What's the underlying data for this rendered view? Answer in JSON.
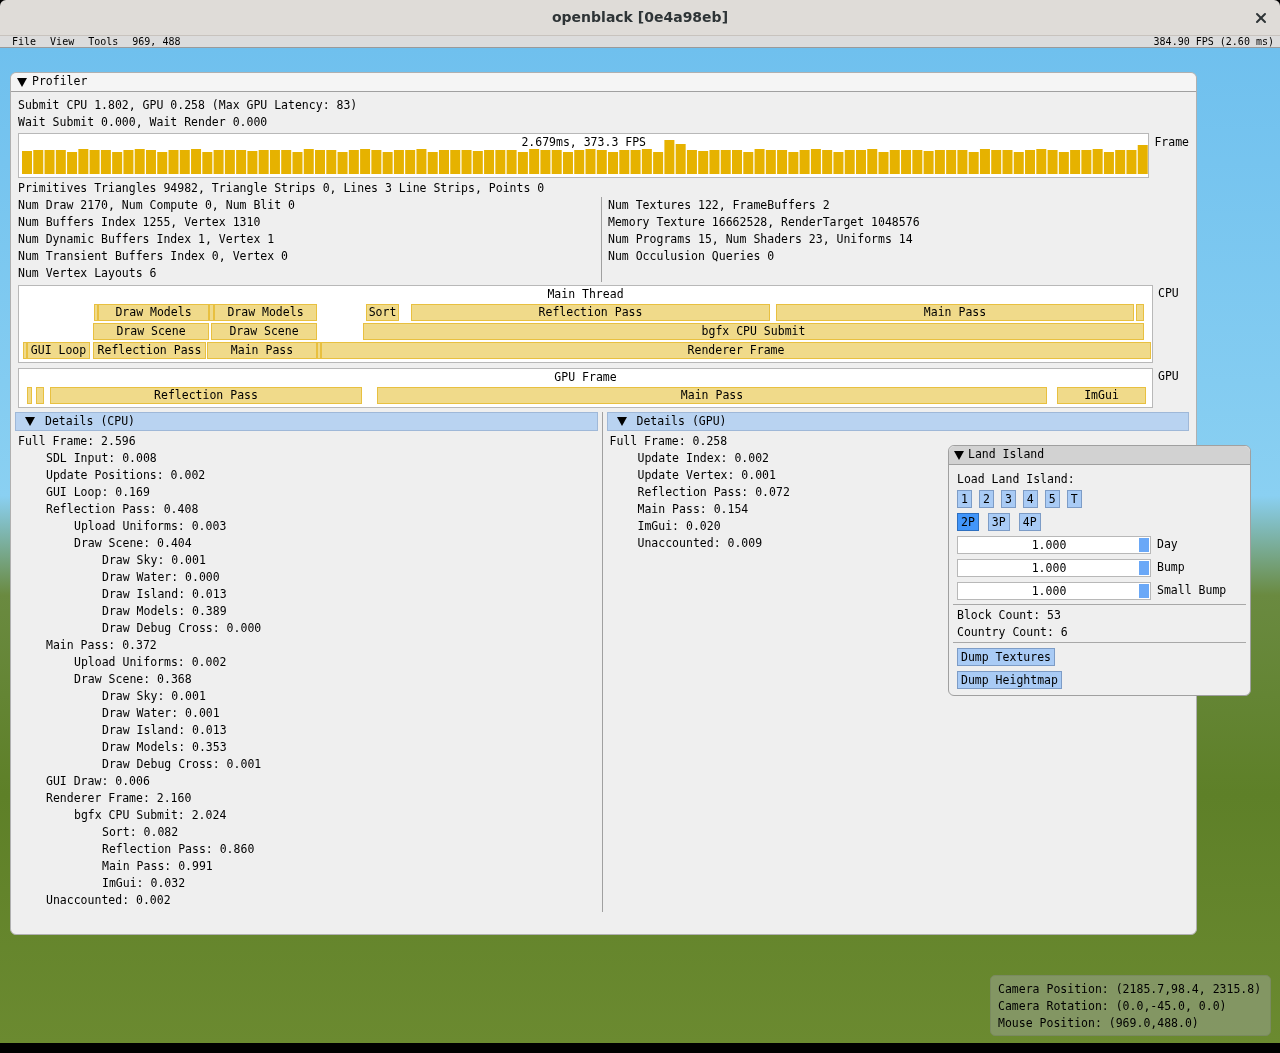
{
  "window": {
    "title": "openblack [0e4a98eb]"
  },
  "menu_bar": {
    "items": [
      "File",
      "View",
      "Tools"
    ],
    "mouse": "969, 488",
    "fps": "384.90 FPS (2.60 ms)"
  },
  "profiler": {
    "title": "Profiler",
    "expanded": true,
    "summary": [
      "Submit CPU 1.802, GPU 0.258 (Max GPU Latency: 83)",
      "Wait Submit 0.000, Wait Render 0.000"
    ],
    "frame_graph": {
      "overlay": "2.679ms, 373.3 FPS",
      "label": "Frame"
    },
    "primitives": "Primitives Triangles 94982, Triangle Strips 0, Lines 3 Line Strips, Points 0",
    "stats_left": [
      "Num Draw 2170, Num Compute 0, Num Blit 0",
      "Num Buffers Index 1255, Vertex 1310",
      "Num Dynamic Buffers Index 1, Vertex 1",
      "Num Transient Buffers Index 0, Vertex 0",
      "Num Vertex Layouts 6"
    ],
    "stats_right": [
      "Num Textures 122, FrameBuffers 2",
      "Memory Texture 16662528, RenderTarget 1048576",
      "Num Programs 15, Num Shaders 23, Uniforms 14",
      "Num Occulusion Queries 0"
    ],
    "cpu_timeline": {
      "title": "Main Thread",
      "label": "CPU",
      "blocks": [
        {
          "label": "Draw Models"
        },
        {
          "label": "Draw Models"
        },
        {
          "label": "Sort"
        },
        {
          "label": "Reflection Pass"
        },
        {
          "label": "Main Pass"
        },
        {
          "label": "Draw Scene"
        },
        {
          "label": "Draw Scene"
        },
        {
          "label": "bgfx CPU Submit"
        },
        {
          "label": "GUI Loop"
        },
        {
          "label": "Reflection Pass"
        },
        {
          "label": "Main Pass"
        },
        {
          "label": "Renderer Frame"
        }
      ]
    },
    "gpu_timeline": {
      "title": "GPU Frame",
      "label": "GPU",
      "blocks": [
        {
          "label": "Reflection Pass"
        },
        {
          "label": "Main Pass"
        },
        {
          "label": "ImGui"
        }
      ]
    },
    "details_cpu": {
      "title": "Details (CPU)",
      "expanded": true,
      "tree": [
        {
          "text": "Full Frame: 2.596",
          "children": [
            {
              "text": "SDL Input: 0.008"
            },
            {
              "text": "Update Positions: 0.002"
            },
            {
              "text": "GUI Loop: 0.169"
            },
            {
              "text": "Reflection Pass: 0.408",
              "children": [
                {
                  "text": "Upload Uniforms: 0.003"
                },
                {
                  "text": "Draw Scene: 0.404",
                  "children": [
                    {
                      "text": "Draw Sky: 0.001"
                    },
                    {
                      "text": "Draw Water: 0.000"
                    },
                    {
                      "text": "Draw Island: 0.013"
                    },
                    {
                      "text": "Draw Models: 0.389"
                    },
                    {
                      "text": "Draw Debug Cross: 0.000"
                    }
                  ]
                }
              ]
            },
            {
              "text": "Main Pass: 0.372",
              "children": [
                {
                  "text": "Upload Uniforms: 0.002"
                },
                {
                  "text": "Draw Scene: 0.368",
                  "children": [
                    {
                      "text": "Draw Sky: 0.001"
                    },
                    {
                      "text": "Draw Water: 0.001"
                    },
                    {
                      "text": "Draw Island: 0.013"
                    },
                    {
                      "text": "Draw Models: 0.353"
                    },
                    {
                      "text": "Draw Debug Cross: 0.001"
                    }
                  ]
                }
              ]
            },
            {
              "text": "GUI Draw: 0.006"
            },
            {
              "text": "Renderer Frame: 2.160",
              "children": [
                {
                  "text": "bgfx CPU Submit: 2.024",
                  "children": [
                    {
                      "text": "Sort: 0.082"
                    },
                    {
                      "text": "Reflection Pass: 0.860"
                    },
                    {
                      "text": "Main Pass: 0.991"
                    },
                    {
                      "text": "ImGui: 0.032"
                    }
                  ]
                }
              ]
            },
            {
              "text": "Unaccounted: 0.002"
            }
          ]
        }
      ]
    },
    "details_gpu": {
      "title": "Details (GPU)",
      "expanded": true,
      "tree": [
        {
          "text": "Full Frame: 0.258",
          "children": [
            {
              "text": "Update Index: 0.002"
            },
            {
              "text": "Update Vertex: 0.001"
            },
            {
              "text": "Reflection Pass: 0.072"
            },
            {
              "text": "Main Pass: 0.154"
            },
            {
              "text": "ImGui: 0.020"
            },
            {
              "text": "Unaccounted: 0.009"
            }
          ]
        }
      ]
    }
  },
  "land_island": {
    "title": "Land Island",
    "expanded": true,
    "load_label": "Load Land Island:",
    "island_buttons": [
      {
        "label": "1"
      },
      {
        "label": "2"
      },
      {
        "label": "3"
      },
      {
        "label": "4"
      },
      {
        "label": "5"
      },
      {
        "label": "T"
      }
    ],
    "player_buttons": [
      {
        "label": "2P",
        "selected": true
      },
      {
        "label": "3P",
        "selected": false
      },
      {
        "label": "4P",
        "selected": false
      }
    ],
    "sliders": [
      {
        "value": "1.000",
        "level": 1,
        "label": "Day"
      },
      {
        "value": "1.000",
        "level": 1,
        "label": "Bump"
      },
      {
        "value": "1.000",
        "level": 1,
        "label": "Small Bump"
      }
    ],
    "counts": [
      "Block Count: 53",
      "Country Count: 6"
    ],
    "actions": [
      "Dump Textures",
      "Dump Heightmap"
    ]
  },
  "camera_overlay": [
    "Camera Position: (2185.7,98.4, 2315.8)",
    "Camera Rotation: (0.0,-45.0, 0.0)",
    "Mouse Position: (969.0,488.0)"
  ]
}
